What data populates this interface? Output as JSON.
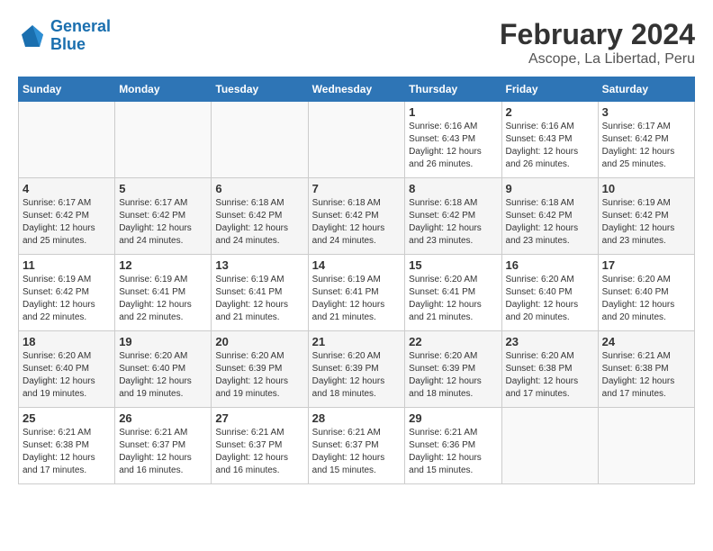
{
  "logo": {
    "line1": "General",
    "line2": "Blue"
  },
  "title": "February 2024",
  "subtitle": "Ascope, La Libertad, Peru",
  "weekdays": [
    "Sunday",
    "Monday",
    "Tuesday",
    "Wednesday",
    "Thursday",
    "Friday",
    "Saturday"
  ],
  "weeks": [
    [
      {
        "day": "",
        "info": ""
      },
      {
        "day": "",
        "info": ""
      },
      {
        "day": "",
        "info": ""
      },
      {
        "day": "",
        "info": ""
      },
      {
        "day": "1",
        "info": "Sunrise: 6:16 AM\nSunset: 6:43 PM\nDaylight: 12 hours\nand 26 minutes."
      },
      {
        "day": "2",
        "info": "Sunrise: 6:16 AM\nSunset: 6:43 PM\nDaylight: 12 hours\nand 26 minutes."
      },
      {
        "day": "3",
        "info": "Sunrise: 6:17 AM\nSunset: 6:42 PM\nDaylight: 12 hours\nand 25 minutes."
      }
    ],
    [
      {
        "day": "4",
        "info": "Sunrise: 6:17 AM\nSunset: 6:42 PM\nDaylight: 12 hours\nand 25 minutes."
      },
      {
        "day": "5",
        "info": "Sunrise: 6:17 AM\nSunset: 6:42 PM\nDaylight: 12 hours\nand 24 minutes."
      },
      {
        "day": "6",
        "info": "Sunrise: 6:18 AM\nSunset: 6:42 PM\nDaylight: 12 hours\nand 24 minutes."
      },
      {
        "day": "7",
        "info": "Sunrise: 6:18 AM\nSunset: 6:42 PM\nDaylight: 12 hours\nand 24 minutes."
      },
      {
        "day": "8",
        "info": "Sunrise: 6:18 AM\nSunset: 6:42 PM\nDaylight: 12 hours\nand 23 minutes."
      },
      {
        "day": "9",
        "info": "Sunrise: 6:18 AM\nSunset: 6:42 PM\nDaylight: 12 hours\nand 23 minutes."
      },
      {
        "day": "10",
        "info": "Sunrise: 6:19 AM\nSunset: 6:42 PM\nDaylight: 12 hours\nand 23 minutes."
      }
    ],
    [
      {
        "day": "11",
        "info": "Sunrise: 6:19 AM\nSunset: 6:42 PM\nDaylight: 12 hours\nand 22 minutes."
      },
      {
        "day": "12",
        "info": "Sunrise: 6:19 AM\nSunset: 6:41 PM\nDaylight: 12 hours\nand 22 minutes."
      },
      {
        "day": "13",
        "info": "Sunrise: 6:19 AM\nSunset: 6:41 PM\nDaylight: 12 hours\nand 21 minutes."
      },
      {
        "day": "14",
        "info": "Sunrise: 6:19 AM\nSunset: 6:41 PM\nDaylight: 12 hours\nand 21 minutes."
      },
      {
        "day": "15",
        "info": "Sunrise: 6:20 AM\nSunset: 6:41 PM\nDaylight: 12 hours\nand 21 minutes."
      },
      {
        "day": "16",
        "info": "Sunrise: 6:20 AM\nSunset: 6:40 PM\nDaylight: 12 hours\nand 20 minutes."
      },
      {
        "day": "17",
        "info": "Sunrise: 6:20 AM\nSunset: 6:40 PM\nDaylight: 12 hours\nand 20 minutes."
      }
    ],
    [
      {
        "day": "18",
        "info": "Sunrise: 6:20 AM\nSunset: 6:40 PM\nDaylight: 12 hours\nand 19 minutes."
      },
      {
        "day": "19",
        "info": "Sunrise: 6:20 AM\nSunset: 6:40 PM\nDaylight: 12 hours\nand 19 minutes."
      },
      {
        "day": "20",
        "info": "Sunrise: 6:20 AM\nSunset: 6:39 PM\nDaylight: 12 hours\nand 19 minutes."
      },
      {
        "day": "21",
        "info": "Sunrise: 6:20 AM\nSunset: 6:39 PM\nDaylight: 12 hours\nand 18 minutes."
      },
      {
        "day": "22",
        "info": "Sunrise: 6:20 AM\nSunset: 6:39 PM\nDaylight: 12 hours\nand 18 minutes."
      },
      {
        "day": "23",
        "info": "Sunrise: 6:20 AM\nSunset: 6:38 PM\nDaylight: 12 hours\nand 17 minutes."
      },
      {
        "day": "24",
        "info": "Sunrise: 6:21 AM\nSunset: 6:38 PM\nDaylight: 12 hours\nand 17 minutes."
      }
    ],
    [
      {
        "day": "25",
        "info": "Sunrise: 6:21 AM\nSunset: 6:38 PM\nDaylight: 12 hours\nand 17 minutes."
      },
      {
        "day": "26",
        "info": "Sunrise: 6:21 AM\nSunset: 6:37 PM\nDaylight: 12 hours\nand 16 minutes."
      },
      {
        "day": "27",
        "info": "Sunrise: 6:21 AM\nSunset: 6:37 PM\nDaylight: 12 hours\nand 16 minutes."
      },
      {
        "day": "28",
        "info": "Sunrise: 6:21 AM\nSunset: 6:37 PM\nDaylight: 12 hours\nand 15 minutes."
      },
      {
        "day": "29",
        "info": "Sunrise: 6:21 AM\nSunset: 6:36 PM\nDaylight: 12 hours\nand 15 minutes."
      },
      {
        "day": "",
        "info": ""
      },
      {
        "day": "",
        "info": ""
      }
    ]
  ]
}
